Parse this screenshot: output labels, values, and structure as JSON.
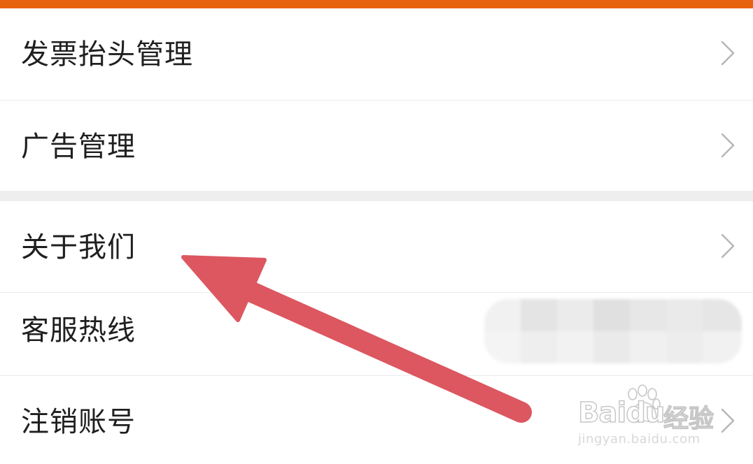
{
  "theme": {
    "accent": "#E8610F",
    "arrow_color": "#DC5760",
    "text_color": "#1F1F1F",
    "chevron_color": "#B5B5B5",
    "gap_color": "#EEEEEE"
  },
  "menu": {
    "group1": [
      {
        "label": "发票抬头管理",
        "icon": "chevron-right-icon"
      },
      {
        "label": "广告管理",
        "icon": "chevron-right-icon"
      }
    ],
    "group2": [
      {
        "label": "关于我们",
        "icon": "chevron-right-icon"
      },
      {
        "label": "客服热线",
        "value_redacted": true
      },
      {
        "label": "注销账号",
        "icon": "chevron-right-icon"
      }
    ]
  },
  "annotation": {
    "type": "arrow",
    "points_to": "关于我们"
  },
  "watermark": {
    "brand": "Baidu",
    "brand_cn": "经验",
    "url": "jingyan.baidu.com"
  }
}
